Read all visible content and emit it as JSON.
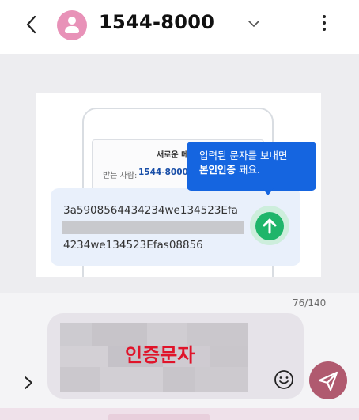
{
  "header": {
    "back_icon": "back-arrow-icon",
    "avatar_icon": "person-icon",
    "title": "1544-8000",
    "dropdown_icon": "chevron-down-icon",
    "menu_icon": "more-vertical-icon"
  },
  "attachment": {
    "inner_screen": {
      "new_message_label": "새로운 메",
      "recipient_label": "받는 사람:",
      "recipient_number": "1544-8000"
    },
    "tooltip": {
      "line1": "입력된 문자를 보내면",
      "line2_bold": "본인인증",
      "line2_rest": " 돼요."
    },
    "message_line1": "3a5908564434234we134523Efa",
    "message_line2": "4234we134523Efas08856",
    "send_icon": "arrow-up-icon"
  },
  "compose": {
    "char_counter": "76/140",
    "expand_icon": "chevron-right-icon",
    "message_text": "인증문자",
    "emoji_icon": "smiley-icon",
    "send_icon": "paper-plane-icon"
  },
  "colors": {
    "avatar": "#e892b8",
    "tooltip": "#1565e0",
    "send_green": "#1fb56a",
    "send_button": "#b05a6f",
    "auth_text": "#e0142a"
  }
}
